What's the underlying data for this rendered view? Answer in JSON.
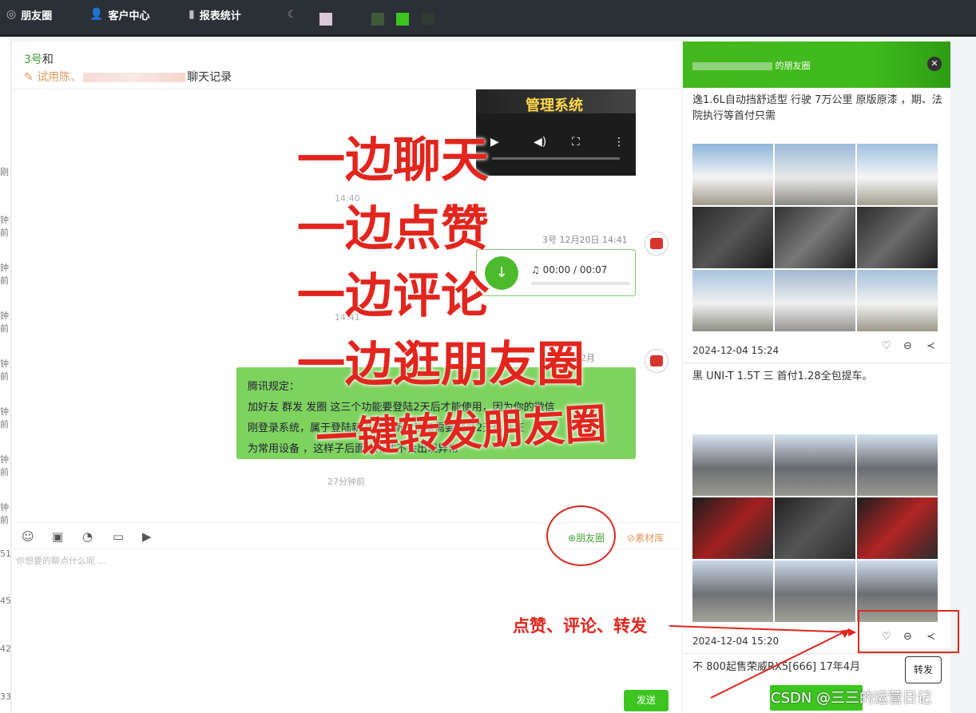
{
  "topbar": {
    "nav": [
      {
        "label": "朋友圈",
        "icon": "aperture-icon"
      },
      {
        "label": "客户中心",
        "icon": "user-icon"
      },
      {
        "label": "报表统计",
        "icon": "bar-chart-icon"
      }
    ]
  },
  "left_times": [
    "刚",
    "钟前",
    "钟前",
    "钟前",
    "钟前",
    "钟前",
    "钟前",
    "钟前",
    "51",
    "45",
    "42",
    "33"
  ],
  "chat": {
    "title_prefix": "3号",
    "title_rest": "和",
    "subtitle_prefix": "试用陈、",
    "subtitle_suffix": "聊天记录",
    "video_title": "管理系统",
    "time1": "14:40",
    "meta1": "3号 12月20日 14:41",
    "audio_time": "00:00 / 00:07",
    "time2": "14:41",
    "meta2": "12月",
    "tip_lines": [
      "腾讯规定：",
      "加好友 群发  发圈  这三个功能要登陆2天后才能使用，因为你的微信",
      "刚登录系统，属于登陆新设备，新的设备需要登录2天后认证",
      "为常用设备 ，这样子后面使用才不会出现异常"
    ],
    "time3": "27分钟前",
    "moments_btn": "⊕朋友圈",
    "material_btn": "素材库",
    "placeholder": "你想要的聊点什么呢 ...",
    "send": "发送"
  },
  "overlay": [
    "一边聊天",
    "一边点赞",
    "一边评论",
    "一边逛朋友圈",
    "一键转发朋友圈"
  ],
  "panel": {
    "title": "的朋友圈",
    "post1_text": "逸1.6L自动挡舒适型 行驶 7万公里 原版原漆 ，期、法院执行等首付只需",
    "post1_date": "2024-12-04 15:24",
    "post2_text": "黑 UNI-T 1.5T 三 首付1.28全包提车。",
    "post2_date": "2024-12-04 15:20",
    "post3_text": "不 800起售荣威RX5[666] 17年4月",
    "forward_tip": "转发"
  },
  "annotation": "点赞、评论、转发",
  "watermark": "CSDN @三三的运营日记"
}
